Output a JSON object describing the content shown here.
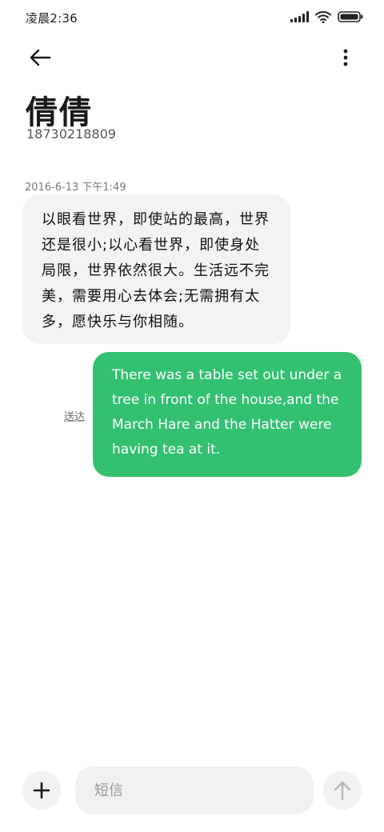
{
  "status_bar": {
    "time": "凌晨2:36",
    "icons": [
      "signal-icon",
      "wifi-icon",
      "battery-icon"
    ]
  },
  "header": {
    "back_icon": "arrow-left-icon",
    "menu_icon": "more-vertical-icon"
  },
  "contact": {
    "name": "倩倩",
    "number": "18730218809"
  },
  "conversation": {
    "timestamp": "2016-6-13 下午1:49",
    "received": {
      "text": "以眼看世界，即使站的最高，世界还是很小;以心看世界，即使身处局限，世界依然很大。生活远不完美，需要用心去体会;无需拥有太多，愿快乐与你相随。"
    },
    "sent": {
      "text": "There was a table set out under a tree in front of the house,and the March Hare and the Hatter were having tea at it.",
      "status": "送达"
    }
  },
  "composer": {
    "add_icon": "plus-icon",
    "placeholder": "短信",
    "send_icon": "arrow-up-icon"
  },
  "colors": {
    "sent_bubble": "#33c171",
    "received_bubble": "#f3f3f3",
    "background": "#ffffff"
  }
}
